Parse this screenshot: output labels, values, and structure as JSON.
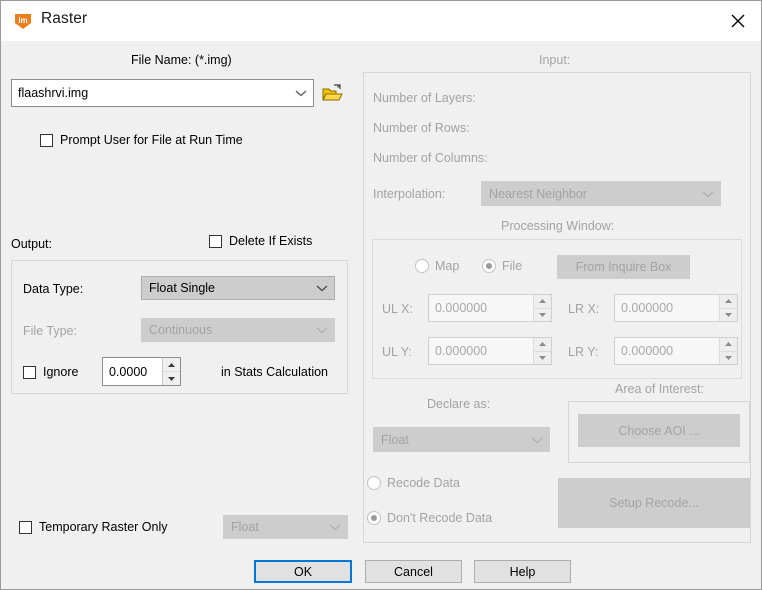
{
  "window": {
    "title": "Raster",
    "icon": "imagine-logo-icon",
    "close_label": "×"
  },
  "left": {
    "file_name_label": "File Name: (*.img)",
    "file_name_value": "flaashrvi.img",
    "browse_icon": "open-folder-icon",
    "prompt_user_checkbox": "Prompt User for File at Run Time",
    "output_label": "Output:",
    "delete_if_exists_checkbox": "Delete If Exists",
    "data_type_label": "Data Type:",
    "data_type_value": "Float Single",
    "file_type_label": "File Type:",
    "file_type_value": "Continuous",
    "ignore_checkbox": "Ignore",
    "ignore_value": "0.0000",
    "in_stats_label": "in Stats Calculation",
    "temporary_raster_checkbox": "Temporary Raster Only",
    "temporary_type_value": "Float"
  },
  "right": {
    "input_label": "Input:",
    "number_of_layers_label": "Number of Layers:",
    "number_of_layers_value": "",
    "number_of_rows_label": "Number of Rows:",
    "number_of_rows_value": "",
    "number_of_columns_label": "Number of Columns:",
    "number_of_columns_value": "",
    "interpolation_label": "Interpolation:",
    "interpolation_value": "Nearest Neighbor",
    "processing_window_label": "Processing Window:",
    "map_radio": "Map",
    "file_radio": "File",
    "from_inquire_box_button": "From Inquire Box",
    "ul_x_label": "UL X:",
    "ul_x_value": "0.000000",
    "lr_x_label": "LR X:",
    "lr_x_value": "0.000000",
    "ul_y_label": "UL Y:",
    "ul_y_value": "0.000000",
    "lr_y_label": "LR Y:",
    "lr_y_value": "0.000000",
    "declare_as_label": "Declare as:",
    "declare_as_value": "Float",
    "area_of_interest_label": "Area of Interest:",
    "choose_aoi_button": "Choose AOI ...",
    "recode_data_radio": "Recode Data",
    "dont_recode_data_radio": "Don't Recode Data",
    "setup_recode_button": "Setup Recode..."
  },
  "footer": {
    "ok_button": "OK",
    "cancel_button": "Cancel",
    "help_button": "Help"
  },
  "colors": {
    "accent": "#0078d7",
    "logo_orange": "#ee7d1b",
    "folder_yellow": "#f2c300",
    "dialog_bg": "#f0f0f0",
    "disabled_text": "#a3a3a3"
  }
}
